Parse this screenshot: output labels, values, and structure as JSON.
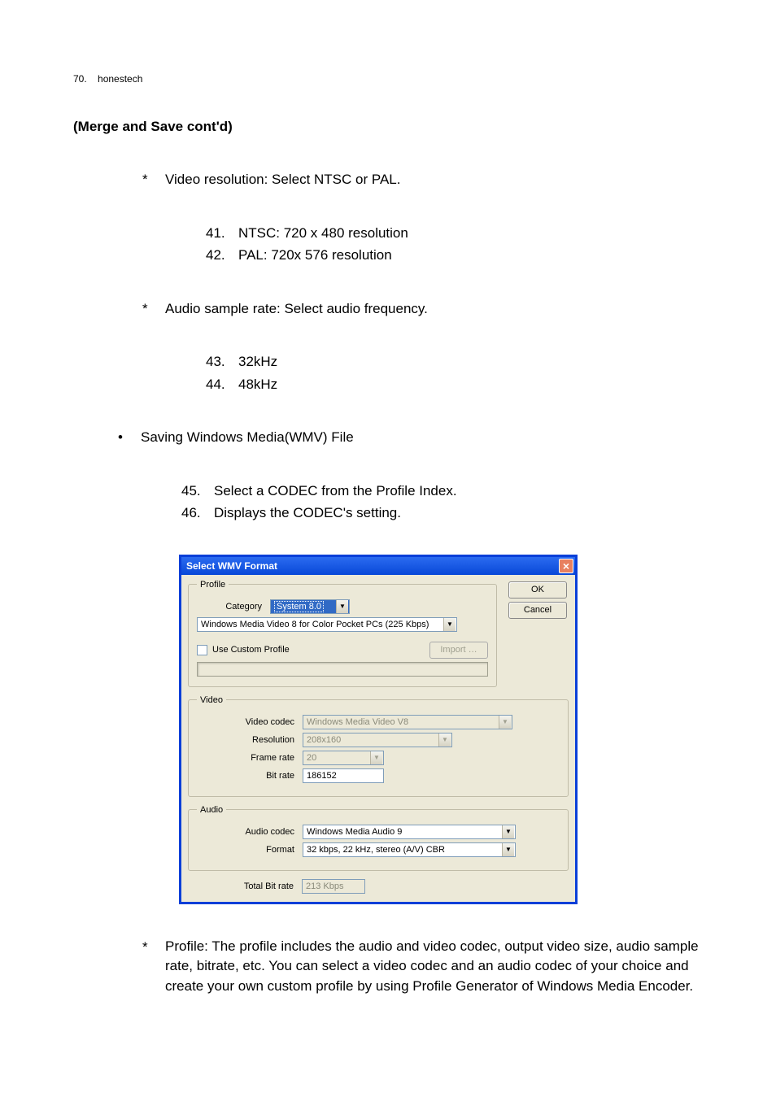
{
  "header": {
    "page_num": "70.",
    "brand": "honestech"
  },
  "heading": "(Merge and Save cont'd)",
  "stars": {
    "video_res": {
      "text": "Video resolution: Select NTSC or PAL.",
      "items": [
        {
          "n": "41.",
          "t": "NTSC: 720 x 480 resolution"
        },
        {
          "n": "42.",
          "t": "PAL: 720x 576 resolution"
        }
      ]
    },
    "audio_rate": {
      "text": "Audio sample rate: Select audio frequency.",
      "items": [
        {
          "n": "43.",
          "t": "32kHz"
        },
        {
          "n": "44.",
          "t": "48kHz"
        }
      ]
    }
  },
  "bullet": {
    "wmv": {
      "text": "Saving Windows Media(WMV) File",
      "items": [
        {
          "n": "45.",
          "t": "Select a CODEC from the Profile Index."
        },
        {
          "n": "46.",
          "t": "Displays the CODEC's setting."
        }
      ]
    }
  },
  "dialog": {
    "title": "Select WMV Format",
    "ok": "OK",
    "cancel": "Cancel",
    "profile": {
      "legend": "Profile",
      "category_label": "Category",
      "category_value": "System 8.0",
      "profile_value": "Windows Media Video 8 for Color Pocket PCs (225 Kbps)",
      "use_custom": "Use Custom Profile",
      "import": "Import …"
    },
    "video": {
      "legend": "Video",
      "codec_label": "Video codec",
      "codec_value": "Windows Media Video V8",
      "res_label": "Resolution",
      "res_value": "208x160",
      "fr_label": "Frame rate",
      "fr_value": "20",
      "br_label": "Bit rate",
      "br_value": "186152"
    },
    "audio": {
      "legend": "Audio",
      "codec_label": "Audio codec",
      "codec_value": "Windows Media Audio 9",
      "fmt_label": "Format",
      "fmt_value": "32 kbps, 22 kHz, stereo (A/V) CBR"
    },
    "total_label": "Total Bit rate",
    "total_value": "213 Kbps"
  },
  "profile_para": "Profile: The profile includes the audio and video codec, output video size, audio sample rate, bitrate, etc. You can select a video codec and an audio codec of your choice and create your own custom profile by using Profile Generator of Windows Media Encoder."
}
